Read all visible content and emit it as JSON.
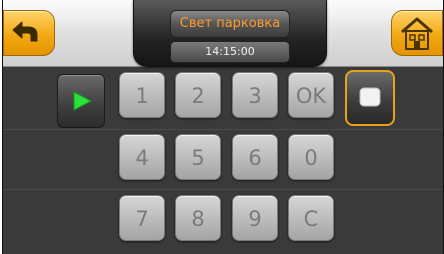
{
  "header": {
    "title": "Свет парковка",
    "time": "14:15:00",
    "back_icon": "back-arrow-icon",
    "home_icon": "home-icon"
  },
  "controls": {
    "play_icon": "play-icon",
    "stop_icon": "stop-icon"
  },
  "keypad": {
    "row1": [
      "1",
      "2",
      "3",
      "OK"
    ],
    "row2": [
      "4",
      "5",
      "6",
      "0"
    ],
    "row3": [
      "7",
      "8",
      "9",
      "C"
    ]
  },
  "colors": {
    "accent": "#f3a914",
    "title_text": "#ff9a2e",
    "background": "#3a3a3a"
  }
}
